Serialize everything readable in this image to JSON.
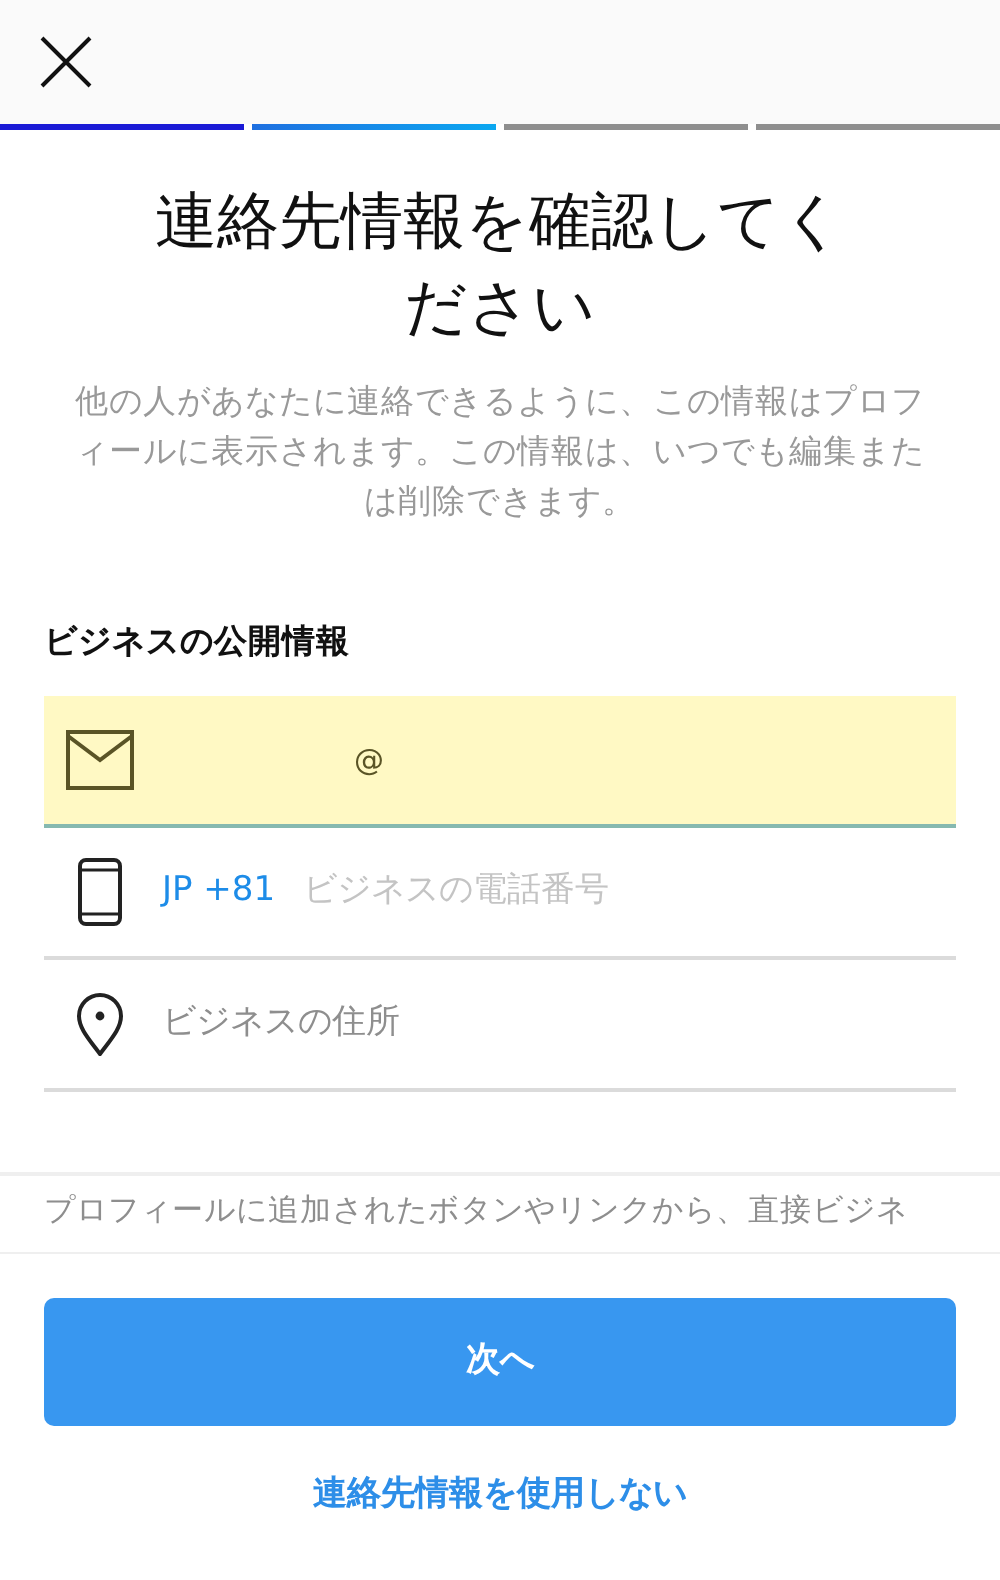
{
  "progress": [
    {
      "filled": true
    },
    {
      "filled": true
    },
    {
      "filled": false
    },
    {
      "filled": false
    }
  ],
  "title": "連絡先情報を確認してください",
  "subtitle": "他の人があなたに連絡できるように、この情報はプロフィールに表示されます。この情報は、いつでも編集または削除できます。",
  "section_label": "ビジネスの公開情報",
  "fields": [
    {
      "kind": "email",
      "value": "@",
      "highlighted": true
    },
    {
      "kind": "phone",
      "prefix": "JP +81",
      "placeholder": "ビジネスの電話番号",
      "highlighted": false
    },
    {
      "kind": "address",
      "placeholder": "ビジネスの住所",
      "highlighted": false
    }
  ],
  "footer_text": "プロフィールに追加されたボタンやリンクから、直接ビジネ",
  "next_button": "次へ",
  "skip_link": "連絡先情報を使用しない"
}
